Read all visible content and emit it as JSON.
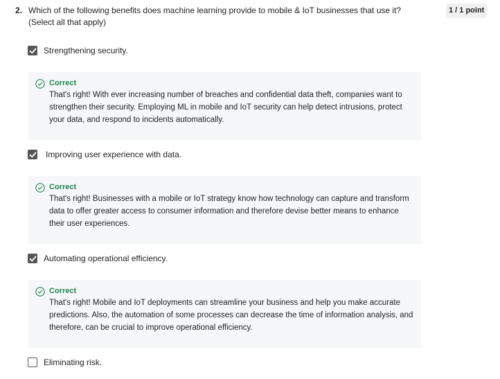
{
  "question": {
    "number": "2.",
    "text": "Which of the following benefits does machine learning provide to  mobile & IoT businesses that use it? (Select all that apply)",
    "points": "1 / 1 point"
  },
  "options": [
    {
      "label": "Strengthening security.",
      "checked": true,
      "feedback": {
        "status": "Correct",
        "text": "That's right! With ever increasing number of breaches and confidential data theft, companies want to strengthen their security. Employing ML in mobile and IoT security can help detect intrusions, protect your data, and respond to incidents automatically."
      }
    },
    {
      "label": "Improving user experience with data.",
      "checked": true,
      "feedback": {
        "status": "Correct",
        "text": "That's right! Businesses with a mobile or IoT strategy know how technology can capture and transform data to offer greater access to consumer information and therefore devise better means to enhance their user experiences."
      }
    },
    {
      "label": "Automating operational efficiency.",
      "checked": true,
      "feedback": {
        "status": "Correct",
        "text": "That's right! Mobile and IoT deployments can streamline your business and help you make accurate predictions. Also, the automation of some processes can decrease the time of information analysis, and therefore, can be crucial to improve operational efficiency."
      }
    },
    {
      "label": "Eliminating risk.",
      "checked": false
    }
  ],
  "colors": {
    "correct_green": "#1f8354",
    "checkbox_fill": "#565656",
    "feedback_bg": "#f5f7f8"
  },
  "icons": {
    "checked": "checkmark-icon",
    "correct": "check-circle-icon"
  }
}
